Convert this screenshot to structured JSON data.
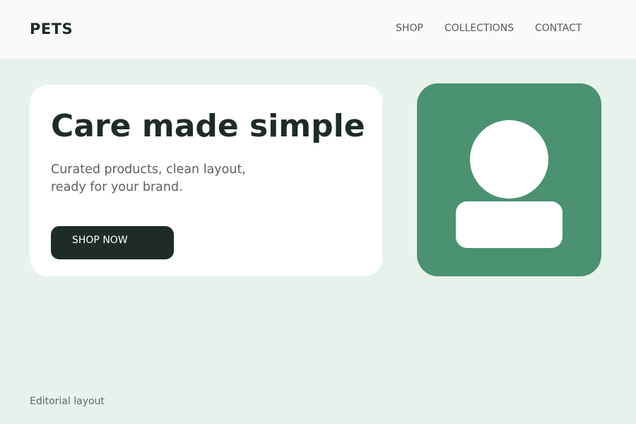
{
  "header": {
    "brand": "PETS",
    "nav": {
      "shop": "SHOP",
      "collections": "COLLECTIONS",
      "contact": "CONTACT"
    }
  },
  "hero": {
    "title": "Care made simple",
    "subtitle": "Curated products, clean layout, ready for your brand.",
    "cta_label": "SHOP NOW"
  },
  "media": {
    "icon": "user-avatar-icon"
  },
  "footer": {
    "note": "Editorial layout"
  },
  "colors": {
    "page_background": "#e8f2ec",
    "header_background": "#fafafa",
    "card_background": "#ffffff",
    "accent_green": "#4a9271",
    "dark": "#1e2b26"
  }
}
